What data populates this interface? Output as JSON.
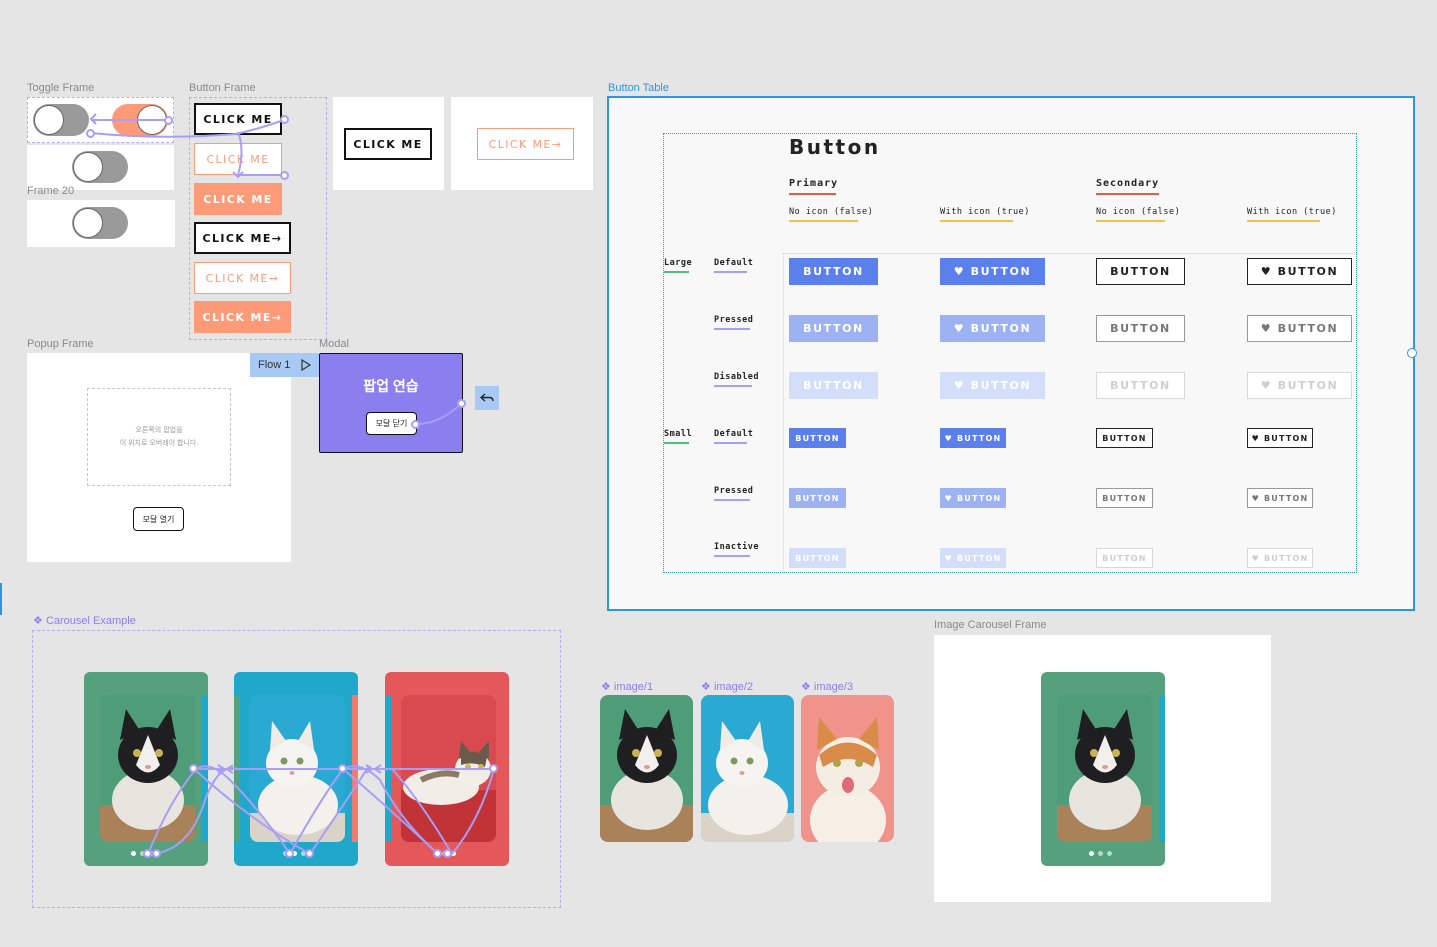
{
  "frames": {
    "toggle": "Toggle Frame",
    "button": "Button Frame",
    "frame20": "Frame 20",
    "popup": "Popup Frame",
    "modal": "Modal",
    "button_table": "Button Table",
    "carousel_example": "Carousel Example",
    "image_carousel": "Image Carousel Frame"
  },
  "click_me": "CLICK ME",
  "click_me_arrow": "CLICK ME→",
  "flow": "Flow 1",
  "modal": {
    "title": "팝업 연습",
    "close": "모달 닫기"
  },
  "popup": {
    "line1": "오른쪽의 팝업을",
    "line2": "이 위치로 오버레이 합니다.",
    "open": "모달 열기"
  },
  "button_table": {
    "title": "Button",
    "primary": "Primary",
    "secondary": "Secondary",
    "no_icon": "No icon (false)",
    "with_icon": "With icon (true)",
    "large": "Large",
    "small": "Small",
    "states": {
      "default": "Default",
      "pressed": "Pressed",
      "disabled": "Disabled",
      "inactive": "Inactive"
    },
    "btn": "BUTTON",
    "btn_icon": "♥ BUTTON",
    "btn_icon_sm": "♥ BUTTON"
  },
  "images": {
    "one": "image/1",
    "two": "image/2",
    "three": "image/3"
  },
  "colors": {
    "accent_orange": "#fd9b78",
    "primary_blue": "#5b80ec",
    "modal_purple": "#8b7ff0",
    "selection_blue": "#2e95e6",
    "card_green": "#55a07d",
    "card_cyan": "#1fa8c9",
    "card_red": "#e5585a"
  }
}
